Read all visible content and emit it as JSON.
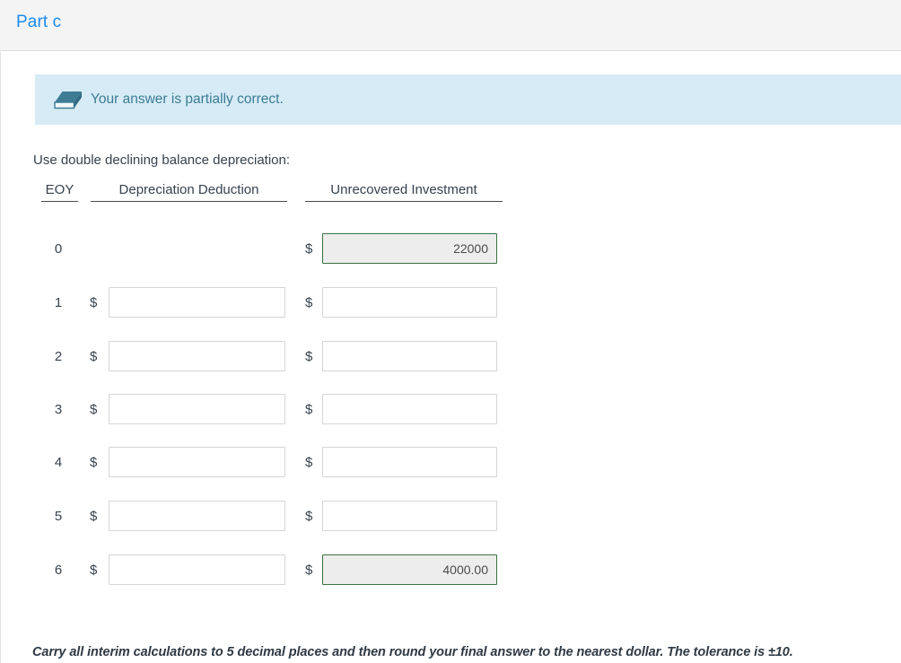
{
  "header": {
    "title": "Part c",
    "title_color": "#1b8bf0",
    "background": "#f4f4f4"
  },
  "banner": {
    "message": "Your answer is partially correct.",
    "icon": "eraser-icon",
    "background": "#d6ebf5",
    "text_color": "#3d7c94"
  },
  "instruction": "Use double declining balance depreciation:",
  "table": {
    "columns": [
      {
        "label": "EOY"
      },
      {
        "label": "Depreciation Deduction"
      },
      {
        "label": "Unrecovered Investment"
      }
    ],
    "currency_symbol": "$",
    "rows": [
      {
        "eoy": "0",
        "depreciation": {
          "value": "",
          "visible": false,
          "locked": false
        },
        "unrecovered": {
          "value": "22000",
          "visible": true,
          "locked": true
        }
      },
      {
        "eoy": "1",
        "depreciation": {
          "value": "",
          "visible": true,
          "locked": false
        },
        "unrecovered": {
          "value": "",
          "visible": true,
          "locked": false
        }
      },
      {
        "eoy": "2",
        "depreciation": {
          "value": "",
          "visible": true,
          "locked": false
        },
        "unrecovered": {
          "value": "",
          "visible": true,
          "locked": false
        }
      },
      {
        "eoy": "3",
        "depreciation": {
          "value": "",
          "visible": true,
          "locked": false
        },
        "unrecovered": {
          "value": "",
          "visible": true,
          "locked": false
        }
      },
      {
        "eoy": "4",
        "depreciation": {
          "value": "",
          "visible": true,
          "locked": false
        },
        "unrecovered": {
          "value": "",
          "visible": true,
          "locked": false
        }
      },
      {
        "eoy": "5",
        "depreciation": {
          "value": "",
          "visible": true,
          "locked": false
        },
        "unrecovered": {
          "value": "",
          "visible": true,
          "locked": false
        }
      },
      {
        "eoy": "6",
        "depreciation": {
          "value": "",
          "visible": true,
          "locked": false
        },
        "unrecovered": {
          "value": "4000.00",
          "visible": true,
          "locked": true
        }
      }
    ],
    "locked_border_color": "#3a7340",
    "locked_fill_color": "#ededed"
  },
  "note": "Carry all interim calculations to 5 decimal places and then round your final answer to the nearest dollar. The tolerance is ±10."
}
